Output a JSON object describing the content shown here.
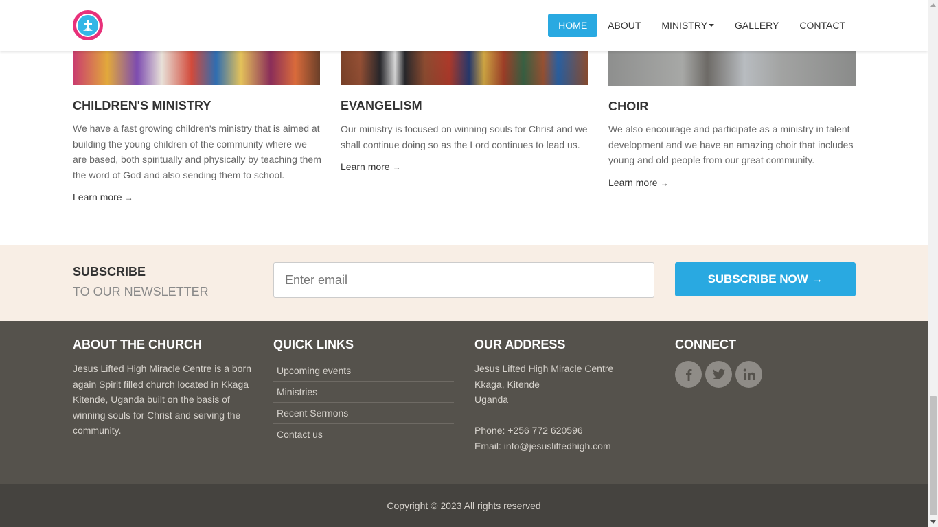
{
  "nav": {
    "items": [
      {
        "label": "HOME",
        "active": true
      },
      {
        "label": "ABOUT",
        "active": false
      },
      {
        "label": "MINISTRY",
        "active": false,
        "dropdown": true
      },
      {
        "label": "GALLERY",
        "active": false
      },
      {
        "label": "CONTACT",
        "active": false
      }
    ]
  },
  "ministries": [
    {
      "title": "CHILDREN'S MINISTRY",
      "text": "We have a fast growing children's ministry that is aimed at building the young children of the community where we are based, both spiritually and physically by teaching them the word of God and also sending them to school.",
      "link": "Learn more",
      "arrow": "→"
    },
    {
      "title": "EVANGELISM",
      "text": "Our ministry is focused on winning souls for Christ and we shall continue doing so as the Lord continues to lead us.",
      "link": "Learn more",
      "arrow": "→"
    },
    {
      "title": "CHOIR",
      "text": "We also encourage and participate as a ministry in talent development and we have an amazing choir that includes young and old people from our great community.",
      "link": "Learn more",
      "arrow": "→"
    }
  ],
  "subscribe": {
    "title": "SUBSCRIBE",
    "subtitle": "TO OUR NEWSLETTER",
    "placeholder": "Enter email",
    "value": "",
    "button": "SUBSCRIBE NOW →"
  },
  "footer": {
    "about": {
      "heading": "ABOUT THE CHURCH",
      "text": "Jesus Lifted High Miracle Centre is a born again Spirit filled church located in Kkaga Kitende, Uganda built on the basis of winning souls for Christ and serving the community."
    },
    "quick_links": {
      "heading": "QUICK LINKS",
      "items": [
        "Upcoming events",
        "Ministries",
        "Recent Sermons",
        "Contact us"
      ]
    },
    "address": {
      "heading": "OUR ADDRESS",
      "line1": "Jesus Lifted High Miracle Centre",
      "line2": "Kkaga, Kitende",
      "line3": "Uganda",
      "phone": "Phone: +256 772 620596",
      "email": "Email: info@jesusliftedhigh.com"
    },
    "connect": {
      "heading": "CONNECT",
      "icons": [
        "facebook-icon",
        "twitter-icon",
        "linkedin-icon"
      ]
    },
    "copyright": "Copyright © 2023 All rights reserved"
  },
  "colors": {
    "accent": "#29a9e1",
    "footer_bg": "#55524c",
    "copyright_bg": "#45433f",
    "subscribe_bg": "#f8eee5"
  }
}
